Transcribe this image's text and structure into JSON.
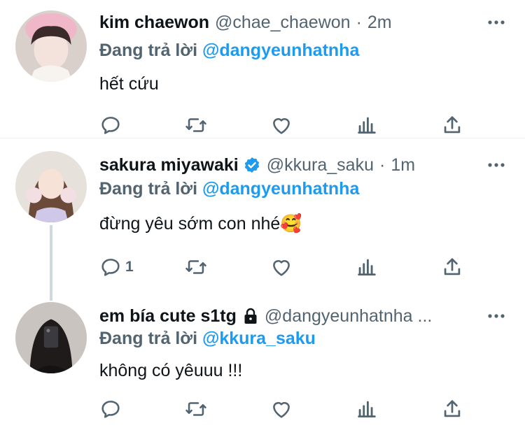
{
  "tweets": [
    {
      "name": "kim chaewon",
      "handle": "@chae_chaewon",
      "separator": "·",
      "time": "2m",
      "replying_label": "Đang trả lời",
      "replying_to": "@dangyeunhatnha",
      "text": "hết cứu",
      "reply_count": "",
      "verified": false,
      "locked": false
    },
    {
      "name": "sakura miyawaki",
      "handle": "@kkura_saku",
      "separator": "·",
      "time": "1m",
      "replying_label": "Đang trả lời",
      "replying_to": "@dangyeunhatnha",
      "text": "đừng yêu sớm con nhé🥰",
      "reply_count": "1",
      "verified": true,
      "locked": false
    },
    {
      "name": "em bía cute s1tg",
      "handle": "@dangyeunhatnha ...",
      "separator": "",
      "time": "",
      "replying_label": "Đang trả lời",
      "replying_to": "@kkura_saku",
      "text": "không có yêuuu !!!",
      "reply_count": "",
      "verified": false,
      "locked": true
    }
  ],
  "icons": {
    "reply": "reply-icon",
    "retweet": "retweet-icon",
    "like": "heart-icon",
    "views": "views-icon",
    "share": "share-icon",
    "more": "more-icon",
    "verified": "verified-badge-icon",
    "lock": "lock-icon"
  },
  "colors": {
    "accent": "#1d9bf0",
    "muted": "#536471",
    "text": "#0f1419",
    "thread_line": "#cfd9de"
  }
}
